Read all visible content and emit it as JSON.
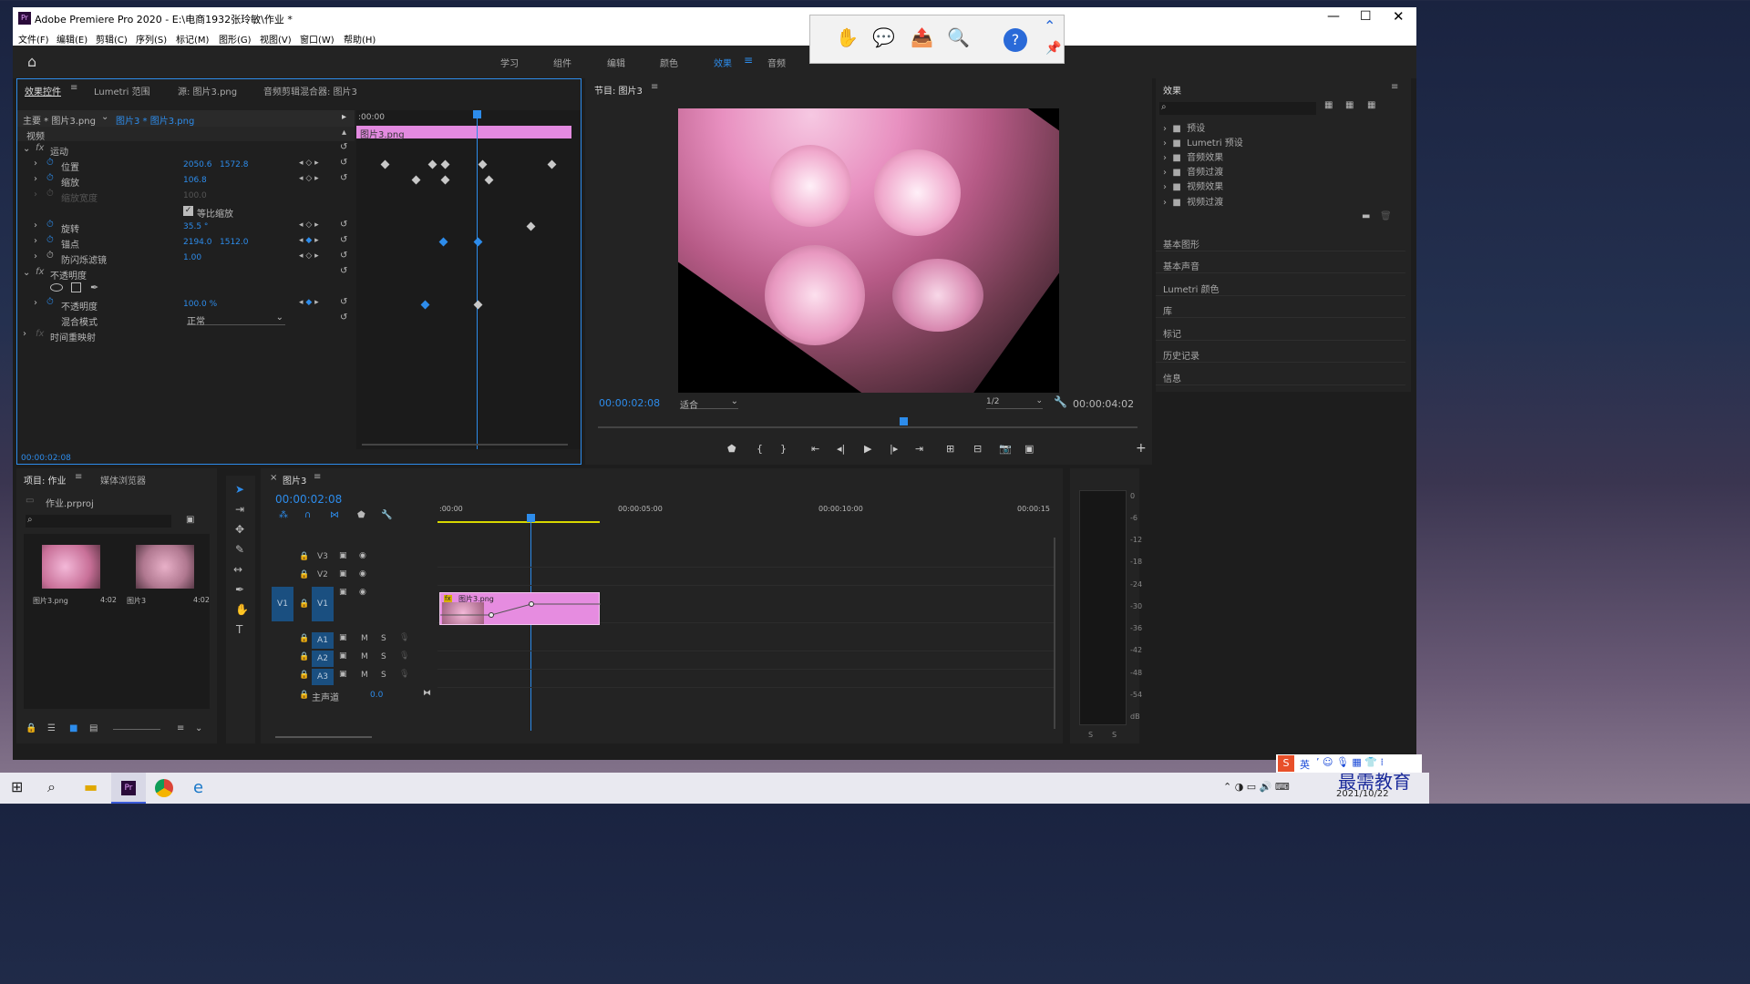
{
  "app": {
    "title": "Adobe Premiere Pro 2020 - E:\\电商1932张玲敏\\作业 *",
    "icon": "Pr"
  },
  "menu": [
    "文件(F)",
    "编辑(E)",
    "剪辑(C)",
    "序列(S)",
    "标记(M)",
    "图形(G)",
    "视图(V)",
    "窗口(W)",
    "帮助(H)"
  ],
  "workspaces": [
    "学习",
    "组件",
    "编辑",
    "颜色",
    "效果",
    "音频"
  ],
  "active_workspace": "效果",
  "effect_controls": {
    "tabs": [
      "效果控件",
      "Lumetri 范围",
      "源: 图片3.png",
      "音频剪辑混合器: 图片3"
    ],
    "master": "主要 * 图片3.png",
    "clip": "图片3 * 图片3.png",
    "video_label": "视频",
    "ruler_start": ":00:00",
    "clip_bar": "图片3.png",
    "motion": "运动",
    "position": {
      "label": "位置",
      "x": "2050.6",
      "y": "1572.8"
    },
    "scale": {
      "label": "缩放",
      "value": "106.8"
    },
    "scale_width": {
      "label": "缩放宽度",
      "value": "100.0"
    },
    "uniform": "等比缩放",
    "rotation": {
      "label": "旋转",
      "value": "35.5 °"
    },
    "anchor": {
      "label": "锚点",
      "x": "2194.0",
      "y": "1512.0"
    },
    "flicker": {
      "label": "防闪烁滤镜",
      "value": "1.00"
    },
    "opacity_group": "不透明度",
    "opacity": {
      "label": "不透明度",
      "value": "100.0 %"
    },
    "blend": {
      "label": "混合模式",
      "value": "正常"
    },
    "time_remap": "时间重映射",
    "timecode": "00:00:02:08"
  },
  "program": {
    "title": "节目: 图片3",
    "timecode": "00:00:02:08",
    "fit": "适合",
    "res": "1/2",
    "duration": "00:00:04:02"
  },
  "effects_panel": {
    "title": "效果",
    "folders": [
      "预设",
      "Lumetri 预设",
      "音频效果",
      "音频过渡",
      "视频效果",
      "视频过渡"
    ],
    "sections": [
      "基本图形",
      "基本声音",
      "Lumetri 颜色",
      "库",
      "标记",
      "历史记录",
      "信息"
    ]
  },
  "project": {
    "tabs": [
      "项目: 作业",
      "媒体浏览器"
    ],
    "file": "作业.prproj",
    "items": [
      {
        "name": "图片3.png",
        "dur": "4:02"
      },
      {
        "name": "图片3",
        "dur": "4:02"
      }
    ]
  },
  "timeline": {
    "title": "图片3",
    "timecode": "00:00:02:08",
    "ruler": [
      ":00:00",
      "00:00:05:00",
      "00:00:10:00",
      "00:00:15"
    ],
    "video_tracks": [
      "V3",
      "V2",
      "V1"
    ],
    "audio_tracks": [
      "A1",
      "A2",
      "A3"
    ],
    "source": "V1",
    "master": "主声道",
    "master_val": "0.0",
    "clip": "图片3.png",
    "m": "M",
    "s": "S"
  },
  "meter": {
    "ticks": [
      "0",
      "-6",
      "-12",
      "-18",
      "-24",
      "-30",
      "-36",
      "-42",
      "-48",
      "-54",
      "dB"
    ],
    "s": "S"
  },
  "taskbar": {
    "date": "2021/10/22",
    "ime": "英",
    "watermark": "最需教育"
  }
}
